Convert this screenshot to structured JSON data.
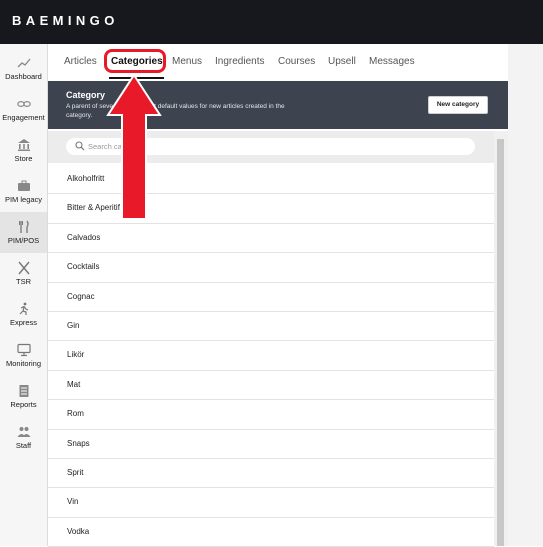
{
  "app": {
    "logo": "BAEMINGO"
  },
  "sidebar": {
    "items": [
      {
        "label": "Dashboard",
        "icon": "trend-icon",
        "active": false
      },
      {
        "label": "Engagement",
        "icon": "infinity-icon",
        "active": false
      },
      {
        "label": "Store",
        "icon": "store-icon",
        "active": false
      },
      {
        "label": "PIM legacy",
        "icon": "briefcase-icon",
        "active": false
      },
      {
        "label": "PIM/POS",
        "icon": "fork-knife-icon",
        "active": true
      },
      {
        "label": "TSR",
        "icon": "crossed-utensils-icon",
        "active": false
      },
      {
        "label": "Express",
        "icon": "runner-icon",
        "active": false
      },
      {
        "label": "Monitoring",
        "icon": "monitor-icon",
        "active": false
      },
      {
        "label": "Reports",
        "icon": "document-icon",
        "active": false
      },
      {
        "label": "Staff",
        "icon": "people-icon",
        "active": false
      }
    ]
  },
  "tabs": [
    {
      "label": "Articles",
      "active": false
    },
    {
      "label": "Categories",
      "active": true
    },
    {
      "label": "Menus",
      "active": false
    },
    {
      "label": "Ingredients",
      "active": false
    },
    {
      "label": "Courses",
      "active": false
    },
    {
      "label": "Upsell",
      "active": false
    },
    {
      "label": "Messages",
      "active": false
    }
  ],
  "category_header": {
    "title": "Category",
    "description": "A parent of several articles. Set default values for new articles created in the category.",
    "new_button": "New category"
  },
  "search": {
    "placeholder": "Search category",
    "value": ""
  },
  "categories": [
    "Alkoholfritt",
    "Bitter & Aperitif",
    "Calvados",
    "Cocktails",
    "Cognac",
    "Gin",
    "Likör",
    "Mat",
    "Rom",
    "Snaps",
    "Sprit",
    "Vin",
    "Vodka"
  ],
  "colors": {
    "topbar": "#16181d",
    "category_header": "#3e4350",
    "annotation": "#e81a2a"
  }
}
